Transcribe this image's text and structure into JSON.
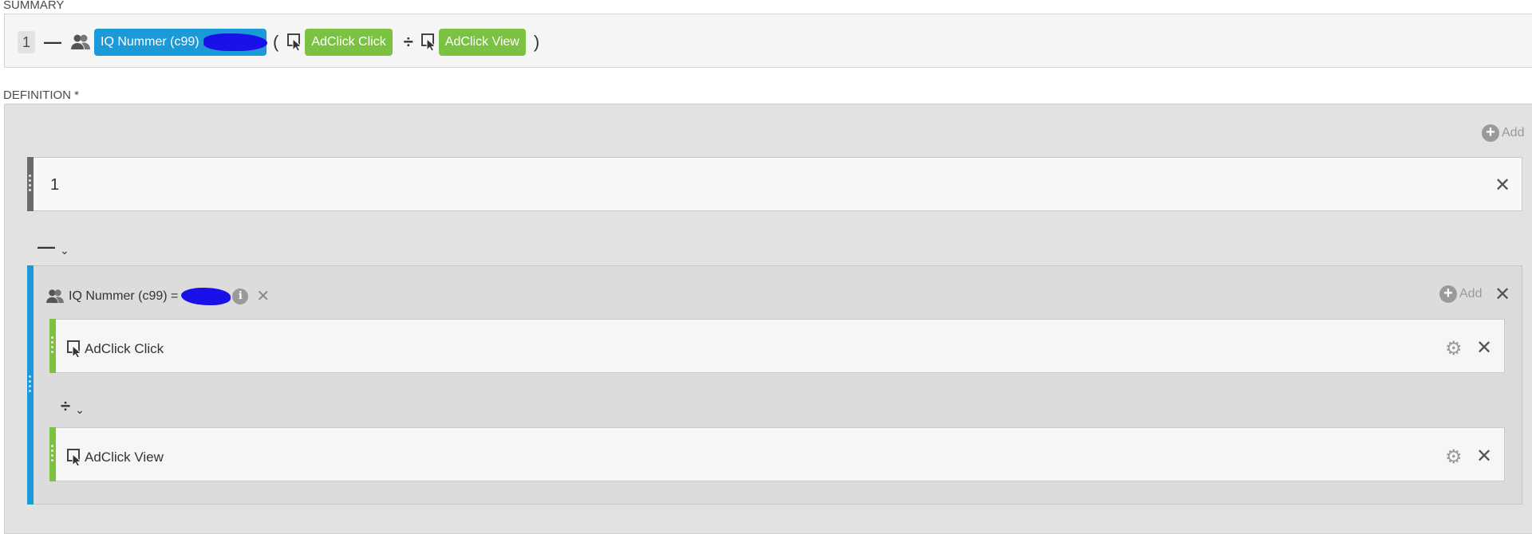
{
  "summary": {
    "label": "SUMMARY",
    "number": "1",
    "minus_op": "—",
    "dimension_chip": "IQ Nummer (c99) =",
    "open_paren": "(",
    "metric1_chip": "AdClick Click",
    "divide_op": "÷",
    "metric2_chip": "AdClick View",
    "close_paren": ")"
  },
  "definition": {
    "label": "DEFINITION *",
    "add_label": "Add",
    "constant_value": "1",
    "operator1": "—",
    "group": {
      "title": "IQ Nummer (c99) =",
      "add_label": "Add",
      "metrics": [
        {
          "label": "AdClick Click"
        },
        {
          "label": "AdClick View"
        }
      ],
      "operator": "÷"
    }
  },
  "colors": {
    "dimension_blue": "#1a9ad9",
    "metric_green": "#7cc242",
    "redaction_blue": "#1a10e8"
  }
}
